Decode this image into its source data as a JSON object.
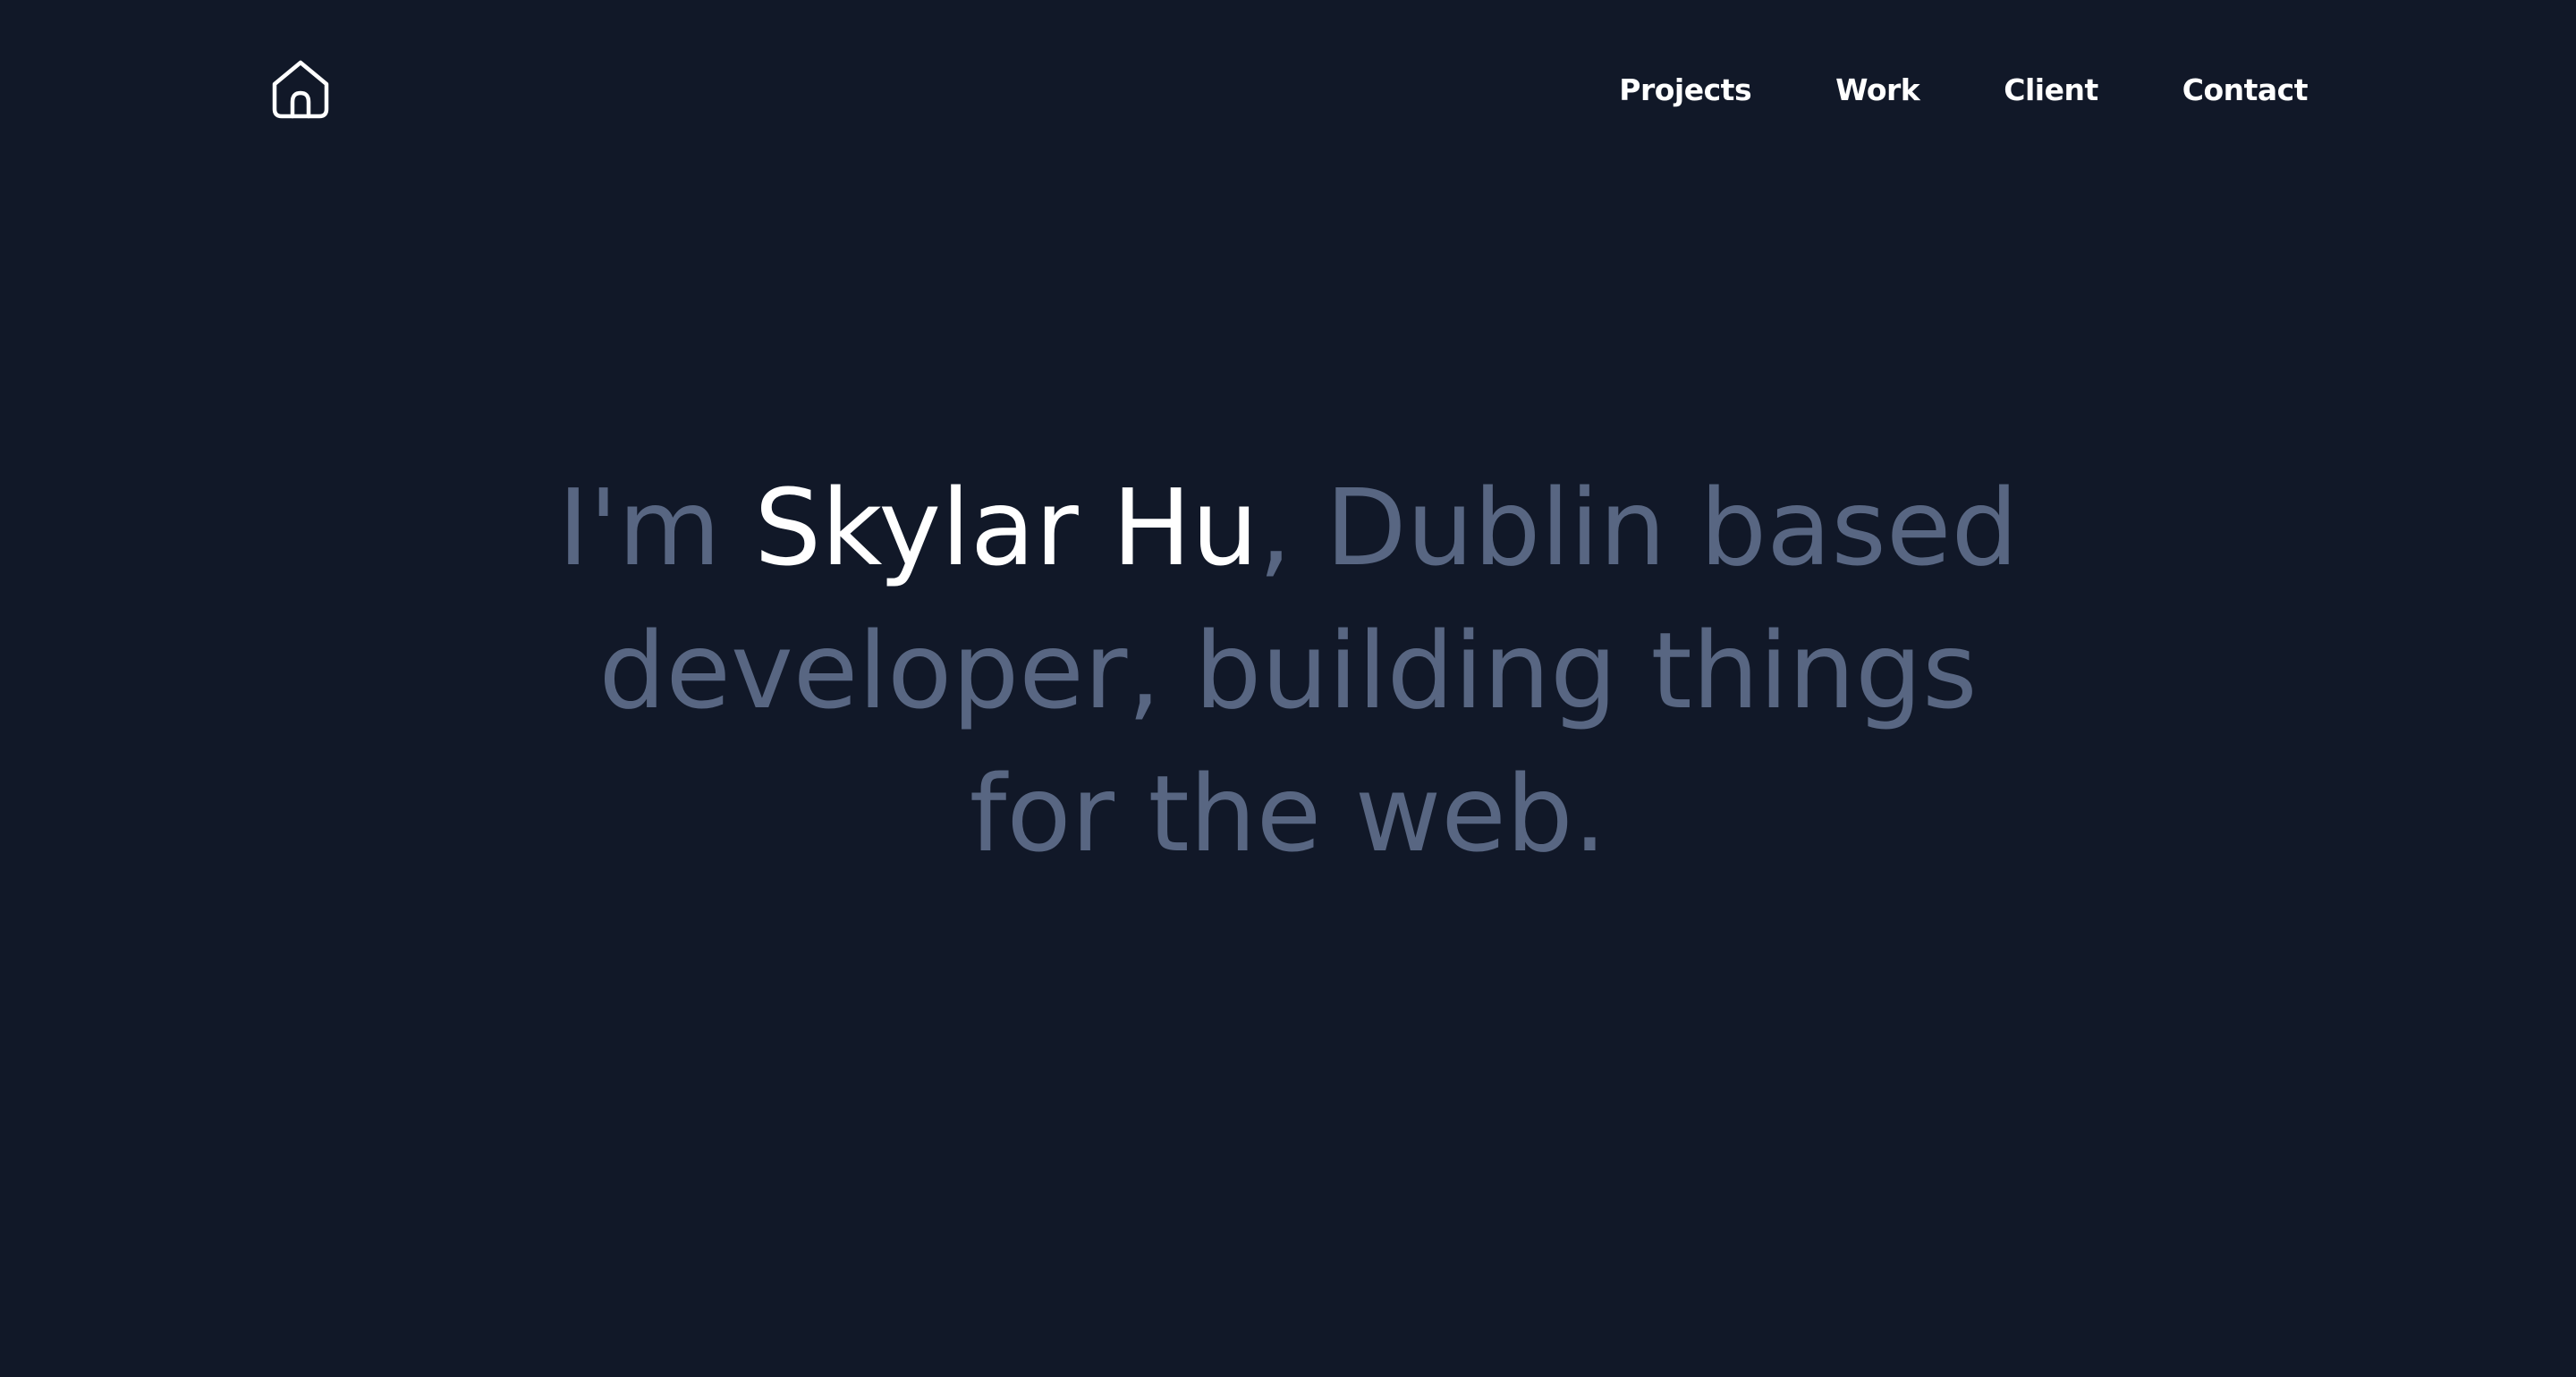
{
  "header": {
    "home_icon": "home-icon",
    "nav": [
      {
        "label": "Projects"
      },
      {
        "label": "Work"
      },
      {
        "label": "Client"
      },
      {
        "label": "Contact"
      }
    ]
  },
  "hero": {
    "prefix": "I'm ",
    "name": "Skylar Hu",
    "line1_suffix": ", Dublin based",
    "line2": "developer, building things",
    "line3": "for the web."
  },
  "colors": {
    "background": "#111828",
    "text_muted": "#586682",
    "text_highlight": "#ffffff",
    "nav_text": "#ffffff"
  }
}
